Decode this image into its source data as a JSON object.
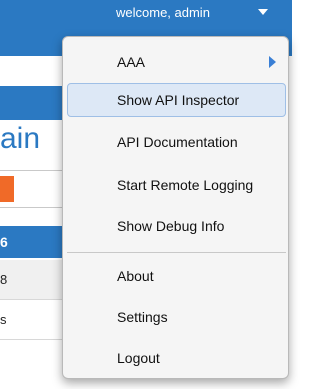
{
  "header": {
    "welcome_text": "welcome, admin"
  },
  "background": {
    "title_fragment": "ain",
    "blue_row_text": "6",
    "rows": [
      "8",
      "s"
    ]
  },
  "menu": {
    "items": [
      {
        "label": "AAA",
        "has_submenu": true
      },
      {
        "label": "Show API Inspector",
        "highlighted": true
      },
      {
        "label": "API Documentation"
      },
      {
        "label": "Start Remote Logging"
      },
      {
        "label": "Show Debug Info"
      },
      {
        "label": "About"
      },
      {
        "label": "Settings"
      },
      {
        "label": "Logout"
      }
    ]
  },
  "colors": {
    "header_blue": "#2b79c2",
    "accent_orange": "#f06a28",
    "highlight": "#dde8f6",
    "submenu_arrow": "#3a7fd5"
  },
  "icons": [
    "chevron-down-icon",
    "submenu-arrow-icon"
  ]
}
